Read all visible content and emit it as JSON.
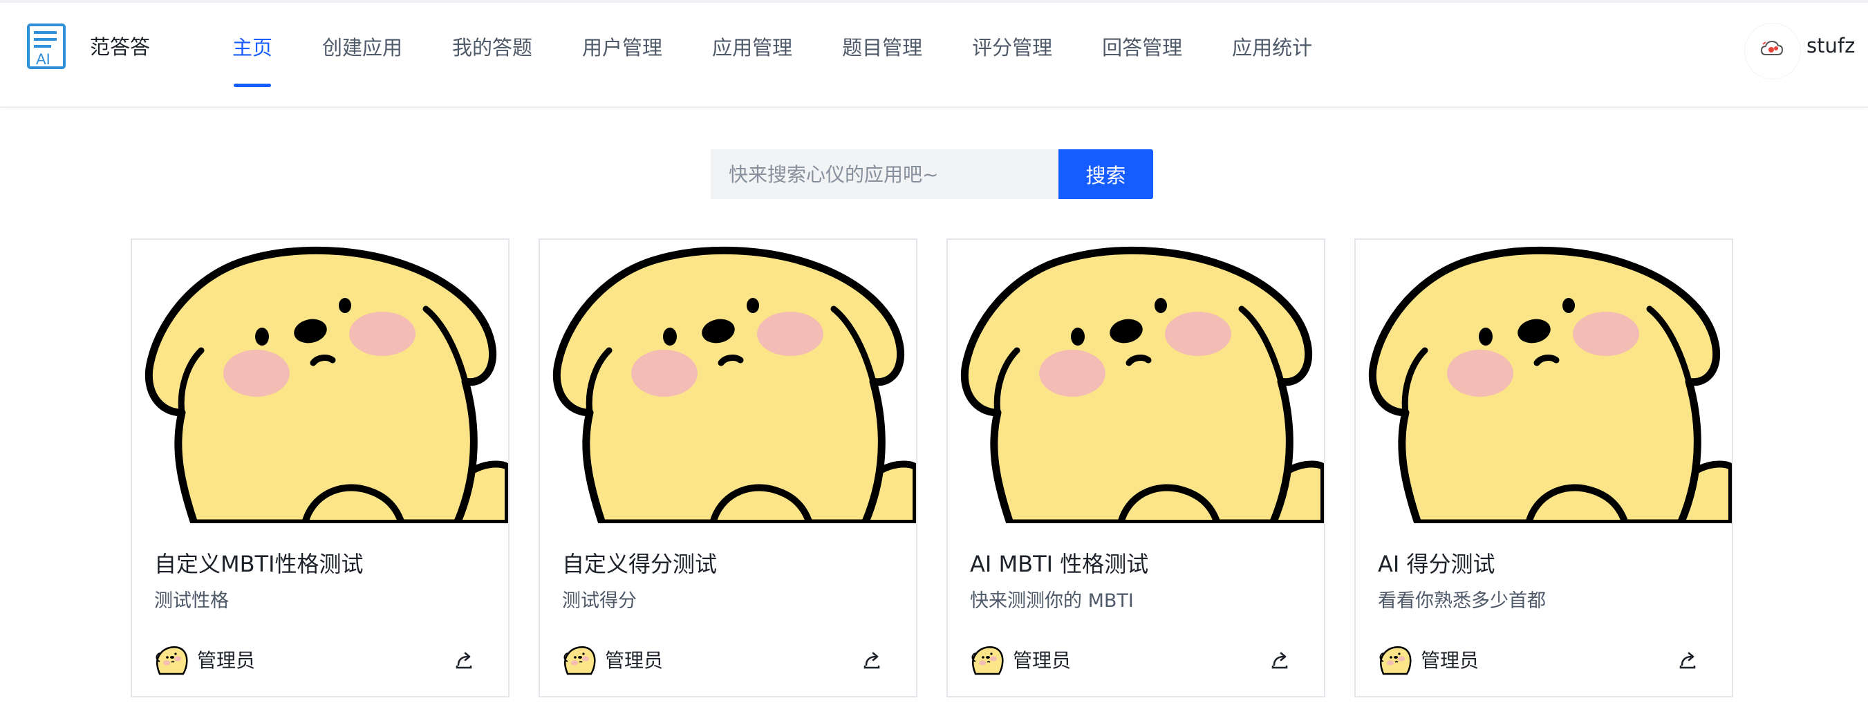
{
  "header": {
    "brand": "范答答",
    "logo_icon": "ai-document-icon",
    "nav": [
      {
        "label": "主页",
        "active": true
      },
      {
        "label": "创建应用",
        "active": false
      },
      {
        "label": "我的答题",
        "active": false
      },
      {
        "label": "用户管理",
        "active": false
      },
      {
        "label": "应用管理",
        "active": false
      },
      {
        "label": "题目管理",
        "active": false
      },
      {
        "label": "评分管理",
        "active": false
      },
      {
        "label": "回答管理",
        "active": false
      },
      {
        "label": "应用统计",
        "active": false
      }
    ],
    "user": {
      "name": "stufz",
      "avatar_icon": "cloud-icon"
    }
  },
  "search": {
    "placeholder": "快来搜索心仪的应用吧~",
    "value": "",
    "button_label": "搜索"
  },
  "cards": [
    {
      "title": "自定义MBTI性格测试",
      "description": "测试性格",
      "author": "管理员",
      "share_icon": "share-icon"
    },
    {
      "title": "自定义得分测试",
      "description": "测试得分",
      "author": "管理员",
      "share_icon": "share-icon"
    },
    {
      "title": "AI MBTI 性格测试",
      "description": "快来测测你的 MBTI",
      "author": "管理员",
      "share_icon": "share-icon"
    },
    {
      "title": "AI 得分测试",
      "description": "看看你熟悉多少首都",
      "author": "管理员",
      "share_icon": "share-icon"
    }
  ],
  "colors": {
    "primary": "#165dff",
    "dog_body": "#fbe588",
    "dog_blush": "#f3bcb5",
    "outline": "#000000"
  }
}
